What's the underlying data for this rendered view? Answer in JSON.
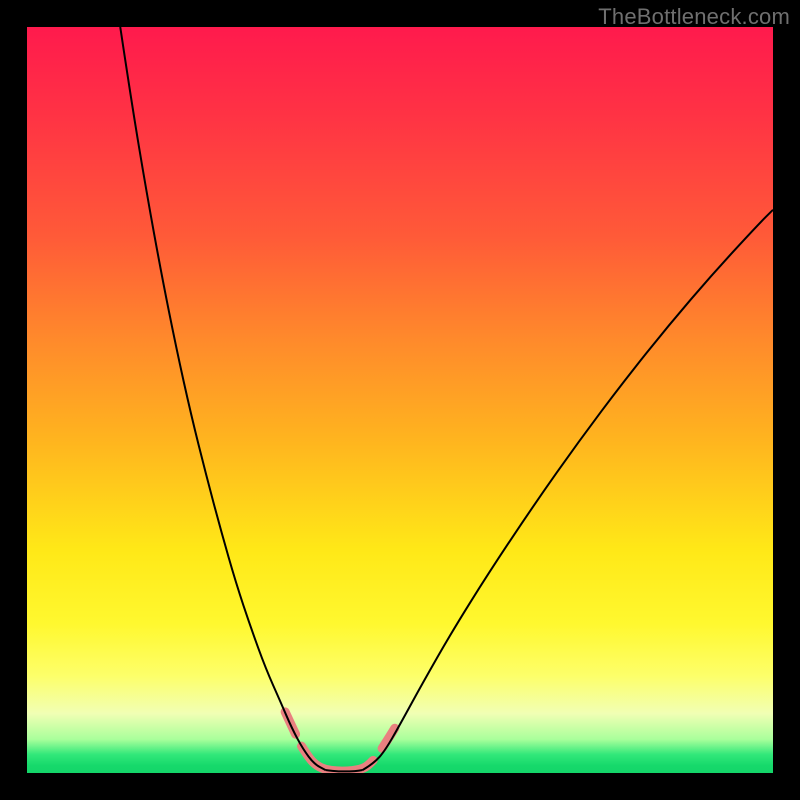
{
  "watermark": "TheBottleneck.com",
  "chart_data": {
    "type": "line",
    "title": "",
    "xlabel": "",
    "ylabel": "",
    "xlim": [
      0,
      100
    ],
    "ylim": [
      0,
      100
    ],
    "background": {
      "kind": "vertical-gradient",
      "stops": [
        {
          "color": "#ff1a4d",
          "pos": 0.0
        },
        {
          "color": "#ff3344",
          "pos": 0.12
        },
        {
          "color": "#ff5a38",
          "pos": 0.28
        },
        {
          "color": "#ff8a2b",
          "pos": 0.42
        },
        {
          "color": "#ffb31f",
          "pos": 0.55
        },
        {
          "color": "#ffe817",
          "pos": 0.7
        },
        {
          "color": "#fff82f",
          "pos": 0.8
        },
        {
          "color": "#fdff6a",
          "pos": 0.87
        },
        {
          "color": "#f1ffb4",
          "pos": 0.92
        },
        {
          "color": "#a9ff9b",
          "pos": 0.955
        },
        {
          "color": "#32e87a",
          "pos": 0.975
        },
        {
          "color": "#16d96b",
          "pos": 0.99
        },
        {
          "color": "#14d569",
          "pos": 1.0
        }
      ]
    },
    "series": [
      {
        "name": "curve-left",
        "stroke": "#000000",
        "strokeWidth": 2,
        "points": [
          {
            "x": 12.5,
            "y": 100.0
          },
          {
            "x": 14.0,
            "y": 90.0
          },
          {
            "x": 16.0,
            "y": 78.0
          },
          {
            "x": 18.0,
            "y": 67.0
          },
          {
            "x": 20.0,
            "y": 57.0
          },
          {
            "x": 22.0,
            "y": 48.0
          },
          {
            "x": 24.0,
            "y": 40.0
          },
          {
            "x": 26.0,
            "y": 32.5
          },
          {
            "x": 28.0,
            "y": 25.5
          },
          {
            "x": 30.0,
            "y": 19.5
          },
          {
            "x": 32.0,
            "y": 14.0
          },
          {
            "x": 34.0,
            "y": 9.5
          },
          {
            "x": 35.5,
            "y": 6.0
          },
          {
            "x": 37.0,
            "y": 3.2
          },
          {
            "x": 38.5,
            "y": 1.2
          },
          {
            "x": 40.0,
            "y": 0.4
          }
        ]
      },
      {
        "name": "curve-valley",
        "stroke": "#000000",
        "strokeWidth": 2,
        "points": [
          {
            "x": 40.0,
            "y": 0.4
          },
          {
            "x": 41.0,
            "y": 0.25
          },
          {
            "x": 42.5,
            "y": 0.2
          },
          {
            "x": 44.0,
            "y": 0.25
          },
          {
            "x": 45.0,
            "y": 0.4
          }
        ]
      },
      {
        "name": "curve-right",
        "stroke": "#000000",
        "strokeWidth": 2,
        "points": [
          {
            "x": 45.0,
            "y": 0.4
          },
          {
            "x": 46.5,
            "y": 1.3
          },
          {
            "x": 48.0,
            "y": 3.0
          },
          {
            "x": 50.0,
            "y": 6.5
          },
          {
            "x": 53.0,
            "y": 12.0
          },
          {
            "x": 57.0,
            "y": 19.0
          },
          {
            "x": 62.0,
            "y": 27.0
          },
          {
            "x": 68.0,
            "y": 36.0
          },
          {
            "x": 74.0,
            "y": 44.5
          },
          {
            "x": 80.0,
            "y": 52.5
          },
          {
            "x": 86.0,
            "y": 60.0
          },
          {
            "x": 92.0,
            "y": 67.0
          },
          {
            "x": 98.0,
            "y": 73.5
          },
          {
            "x": 100.0,
            "y": 75.5
          }
        ]
      },
      {
        "name": "band-left-upper",
        "stroke": "#e98080",
        "strokeWidth": 9,
        "cap": "round",
        "points": [
          {
            "x": 34.6,
            "y": 8.2
          },
          {
            "x": 35.3,
            "y": 6.7
          },
          {
            "x": 36.0,
            "y": 5.2
          }
        ]
      },
      {
        "name": "band-left-lower",
        "stroke": "#e98080",
        "strokeWidth": 9,
        "cap": "round",
        "points": [
          {
            "x": 36.8,
            "y": 3.6
          },
          {
            "x": 37.8,
            "y": 2.0
          },
          {
            "x": 38.8,
            "y": 1.0
          },
          {
            "x": 40.0,
            "y": 0.45
          },
          {
            "x": 41.5,
            "y": 0.25
          },
          {
            "x": 43.0,
            "y": 0.25
          },
          {
            "x": 44.2,
            "y": 0.4
          },
          {
            "x": 45.0,
            "y": 0.6
          },
          {
            "x": 45.7,
            "y": 1.0
          },
          {
            "x": 46.4,
            "y": 1.7
          }
        ]
      },
      {
        "name": "band-right",
        "stroke": "#e98080",
        "strokeWidth": 9,
        "cap": "round",
        "points": [
          {
            "x": 47.6,
            "y": 3.3
          },
          {
            "x": 48.5,
            "y": 4.7
          },
          {
            "x": 49.3,
            "y": 6.0
          }
        ]
      }
    ]
  }
}
